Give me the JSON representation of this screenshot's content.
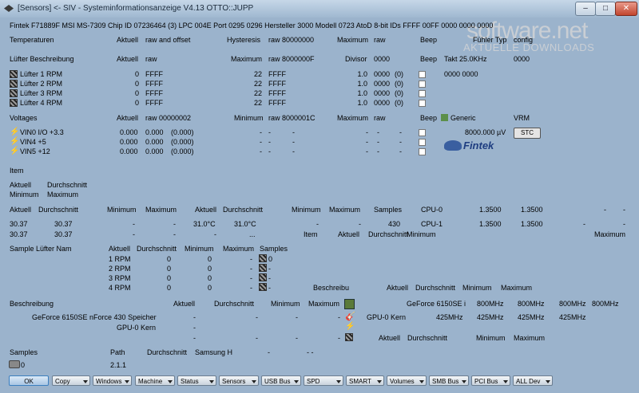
{
  "window": {
    "title": "[Sensors] <- SIV - Systeminformationsanzeige V4.13 OTTO::JUPP"
  },
  "watermark": {
    "big": "software.net",
    "small": "AKTUELLE DOWNLOADS"
  },
  "info_line": "Fintek F71889F MSI MS-7309  Chip ID 07236464 (3)  LPC 004E  Port 0295 0296  Hersteller 3000  Modell 0723  AtoD 8-bit  IDs FFFF 00FF 0000 0000 0000",
  "temps": {
    "h1": "Temperaturen",
    "h2": "Aktuell",
    "h3": "raw and offset",
    "h4": "Hysteresis",
    "h5": "raw 80000000",
    "h6": "Maximum",
    "h7": "raw",
    "h8": "Beep",
    "h9": "Fühler Typ",
    "h10": "config"
  },
  "fans": {
    "h1": "Lüfter Beschreibung",
    "h2": "Aktuell",
    "h3": "raw",
    "h4": "Maximum",
    "h5": "raw 8000000F",
    "h6": "Divisor",
    "h7": "0000",
    "h8": "Beep",
    "h9": "Takt 25.0KHz",
    "h10": "0000",
    "extra": "0000  0000",
    "rows": [
      {
        "name": "Lüfter 1 RPM",
        "cur": "0",
        "raw": "FFFF",
        "max": "22",
        "mraw": "FFFF",
        "div": "1.0",
        "draw": "0000",
        "dv": "(0)"
      },
      {
        "name": "Lüfter 2 RPM",
        "cur": "0",
        "raw": "FFFF",
        "max": "22",
        "mraw": "FFFF",
        "div": "1.0",
        "draw": "0000",
        "dv": "(0)"
      },
      {
        "name": "Lüfter 3 RPM",
        "cur": "0",
        "raw": "FFFF",
        "max": "22",
        "mraw": "FFFF",
        "div": "1.0",
        "draw": "0000",
        "dv": "(0)"
      },
      {
        "name": "Lüfter 4 RPM",
        "cur": "0",
        "raw": "FFFF",
        "max": "22",
        "mraw": "FFFF",
        "div": "1.0",
        "draw": "0000",
        "dv": "(0)"
      }
    ]
  },
  "volts": {
    "h1": "Voltages",
    "h2": "Aktuell",
    "h3": "raw 00000002",
    "h4": "Minimum",
    "h5": "raw 8000001C",
    "h6": "Maximum",
    "h7": "raw",
    "h8": "Beep",
    "h9": "Generic",
    "h10": "VRM",
    "vrm": "8000.000 µV",
    "stc": "STC",
    "logo": "Fintek",
    "rows": [
      {
        "name": "VIN0 I/O +3.3",
        "cur": "0.000",
        "raw": "0.000",
        "rawp": "(0.000)"
      },
      {
        "name": "VIN4 +5",
        "cur": "0.000",
        "raw": "0.000",
        "rawp": "(0.000)"
      },
      {
        "name": "VIN5 +12",
        "cur": "0.000",
        "raw": "0.000",
        "rawp": "(0.000)"
      }
    ]
  },
  "cpu": {
    "item": "Item",
    "aktuell": "Aktuell",
    "durch": "Durchschnitt",
    "minimum": "Minimum",
    "maximum": "Maximum",
    "r1": {
      "a": "Aktuell",
      "b": "Durchschnitt",
      "c": "Minimum",
      "d": "Maximum",
      "e": "Aktuell",
      "f": "Durchschnitt",
      "g": "Minimum",
      "h": "Maximum",
      "i": "Samples",
      "j": "CPU-0",
      "k": "1.3500",
      "l": "1.3500",
      "m": "-",
      "n": "-"
    },
    "r2": {
      "a": "30.37",
      "b": "30.37",
      "c": "-",
      "d": "-",
      "e": "31.0°C",
      "f": "31.0°C",
      "g": "-",
      "h": "-",
      "i": "430",
      "j": "CPU-1",
      "k": "1.3500",
      "l": "1.3500",
      "m": "-",
      "n": "-"
    },
    "r3": {
      "a": "30.37",
      "b": "30.37",
      "c": "-",
      "d": "-",
      "e": "-",
      "f": "...",
      "g": "Item",
      "h": "Aktuell",
      "i": "Durchschnitt",
      "j": "Minimum",
      "k": "Maximum"
    }
  },
  "samples_fans": {
    "h1": "Sample Lüfter Nam",
    "h2": "Aktuell",
    "h3": "Durchschnitt",
    "h4": "Minimum",
    "h5": "Maximum",
    "h6": "Samples",
    "rows": [
      {
        "name": "1 RPM",
        "a": "0",
        "b": "0",
        "c": "-",
        "d": "0"
      },
      {
        "name": "2 RPM",
        "a": "0",
        "b": "0",
        "c": "-",
        "d": "-"
      },
      {
        "name": "3 RPM",
        "a": "0",
        "b": "0",
        "c": "-",
        "d": "-"
      },
      {
        "name": "4 RPM",
        "a": "0",
        "b": "0",
        "c": "-",
        "d": "-"
      }
    ],
    "right": {
      "a": "Beschreibu",
      "b": "Aktuell",
      "c": "Durchschnitt",
      "d": "Minimum",
      "e": "Maximum"
    }
  },
  "gpu": {
    "h1": "Beschreibung",
    "h2": "Aktuell",
    "h3": "Durchschnitt",
    "h4": "Minimum",
    "h5": "Maximum",
    "r1": "GeForce 6150SE nForce 430 Speicher",
    "r2": "GPU-0 Kern",
    "d": [
      "-",
      "-",
      "-",
      "-"
    ],
    "right1": {
      "a": "GeForce 6150SE i",
      "b": "800MHz",
      "c": "800MHz",
      "d": "800MHz",
      "e": "800MHz"
    },
    "right2": {
      "a": "GPU-0 Kern",
      "b": "425MHz",
      "c": "425MHz",
      "d": "425MHz",
      "e": "425MHz"
    },
    "right3": {
      "a": "Aktuell",
      "b": "Durchschnitt",
      "c": "Minimum",
      "d": "Maximum"
    }
  },
  "disk": {
    "h1": "Samples",
    "h2": "Path",
    "h3": "Durchschnitt",
    "h4": "Samsung H",
    "h5": "-",
    "h6": "-  -",
    "v1": "0",
    "v2": "2.1.1"
  },
  "buttons": [
    "OK",
    "Copy",
    "Windows",
    "Machine",
    "Status",
    "Sensors",
    "USB Bus",
    "SPD",
    "SMART",
    "Volumes",
    "SMB Bus",
    "PCI Bus",
    "ALL Dev"
  ]
}
